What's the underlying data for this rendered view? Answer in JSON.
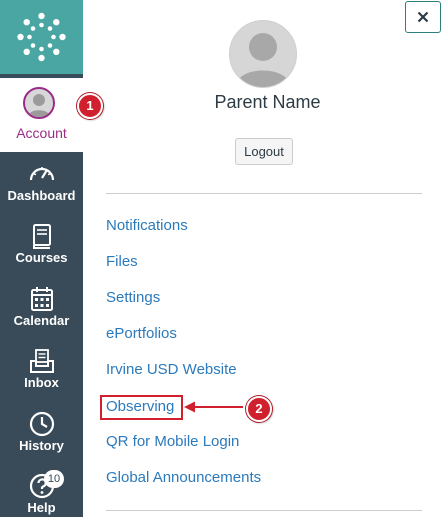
{
  "sidebar": {
    "logo_icon": "canvas-logo-icon",
    "account": {
      "label": "Account",
      "icon": "user-avatar-icon"
    },
    "items": [
      {
        "label": "Dashboard",
        "icon": "dashboard-gauge-icon"
      },
      {
        "label": "Courses",
        "icon": "book-icon"
      },
      {
        "label": "Calendar",
        "icon": "calendar-icon"
      },
      {
        "label": "Inbox",
        "icon": "inbox-icon"
      },
      {
        "label": "History",
        "icon": "clock-icon"
      },
      {
        "label": "Help",
        "icon": "question-icon",
        "badge": "10"
      }
    ]
  },
  "steps": {
    "one": "1",
    "two": "2"
  },
  "tray": {
    "close_icon": "close-icon",
    "user_name": "Parent Name",
    "logout_label": "Logout",
    "links": [
      "Notifications",
      "Files",
      "Settings",
      "ePortfolios",
      "Irvine USD Website",
      "Observing",
      "QR for Mobile Login",
      "Global Announcements"
    ]
  },
  "colors": {
    "nav_background": "#394b58",
    "logo_background": "#4aa6a3",
    "active_accent": "#9a2b88",
    "link": "#2b7abc",
    "annotation_red": "#d0202e"
  }
}
